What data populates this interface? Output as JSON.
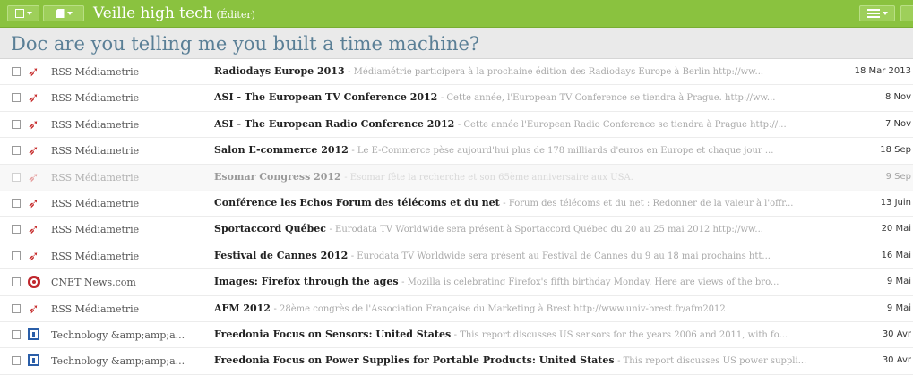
{
  "toolbar": {
    "folder_title": "Veille high tech",
    "edit_label": "(Éditer)"
  },
  "heading": "Doc are you telling me you built a time machine?",
  "colors": {
    "toolbar_green": "#8ac23f",
    "heading_blue": "#5a7f96",
    "rss_red": "#c62c2c",
    "cnet_red": "#c0272d",
    "tech_blue": "#2a5ea8"
  },
  "rows": [
    {
      "icon": "rss-icon",
      "source": "RSS Médiametrie",
      "title": "Radiodays Europe 2013",
      "snippet": "- Médiamétrie participera à la prochaine édition des Radiodays Europe à Berlin http://ww...",
      "date": "18 Mar 2013",
      "faded": false
    },
    {
      "icon": "rss-icon",
      "source": "RSS Médiametrie",
      "title": "ASI - The European TV Conference 2012",
      "snippet": "- Cette année, l'European TV Conference se tiendra à Prague. http://ww...",
      "date": "8 Nov",
      "faded": false
    },
    {
      "icon": "rss-icon",
      "source": "RSS Médiametrie",
      "title": "ASI - The European Radio Conference 2012",
      "snippet": "- Cette année l'European Radio Conference se tiendra à Prague http://...",
      "date": "7 Nov",
      "faded": false
    },
    {
      "icon": "rss-icon",
      "source": "RSS Médiametrie",
      "title": "Salon E-commerce 2012",
      "snippet": "- Le E-Commerce pèse aujourd'hui plus de 178 milliards d'euros en Europe et chaque jour ...",
      "date": "18 Sep",
      "faded": false
    },
    {
      "icon": "rss-icon",
      "source": "RSS Médiametrie",
      "title": "Esomar Congress 2012",
      "snippet": "- Esomar fête la recherche et son 65ème anniversaire aux USA.",
      "date": "9 Sep",
      "faded": true
    },
    {
      "icon": "rss-icon",
      "source": "RSS Médiametrie",
      "title": "Conférence les Echos Forum des télécoms et du net",
      "snippet": "- Forum des télécoms et du net : Redonner de la valeur à l'offr...",
      "date": "13 Juin",
      "faded": false
    },
    {
      "icon": "rss-icon",
      "source": "RSS Médiametrie",
      "title": "Sportaccord Québec",
      "snippet": "- Eurodata TV Worldwide sera présent à Sportaccord Québec du 20 au 25 mai 2012 http://ww...",
      "date": "20 Mai",
      "faded": false
    },
    {
      "icon": "rss-icon",
      "source": "RSS Médiametrie",
      "title": "Festival de Cannes 2012",
      "snippet": "- Eurodata TV Worldwide sera présent au Festival de Cannes du 9 au 18 mai prochains htt...",
      "date": "16 Mai",
      "faded": false
    },
    {
      "icon": "cnet-icon",
      "source": "CNET News.com",
      "title": "Images: Firefox through the ages",
      "snippet": "- Mozilla is celebrating Firefox's fifth birthday Monday. Here are views of the bro...",
      "date": "9 Mai",
      "faded": false
    },
    {
      "icon": "rss-icon",
      "source": "RSS Médiametrie",
      "title": "AFM 2012",
      "snippet": "- 28ème congrès de l'Association Française du Marketing à Brest http://www.univ-brest.fr/afm2012",
      "date": "9 Mai",
      "faded": false
    },
    {
      "icon": "tech-icon",
      "source": "Technology &amp;amp;a...",
      "title": "Freedonia Focus on Sensors: United States",
      "snippet": "- This report discusses US sensors for the years 2006 and 2011, with fo...",
      "date": "30 Avr",
      "faded": false
    },
    {
      "icon": "tech-icon",
      "source": "Technology &amp;amp;a...",
      "title": "Freedonia Focus on Power Supplies for Portable Products: United States",
      "snippet": "- This report discusses US power suppli...",
      "date": "30 Avr",
      "faded": false
    }
  ]
}
